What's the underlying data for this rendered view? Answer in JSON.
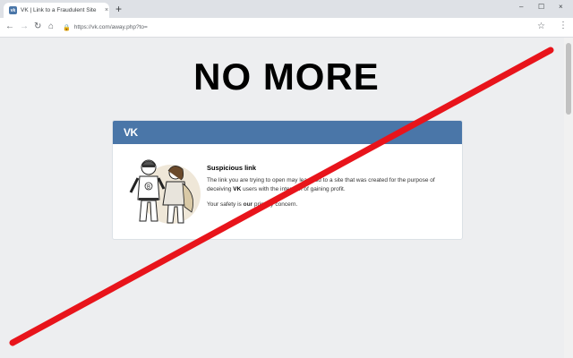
{
  "browser": {
    "tab_title": "VK | Link to a Fraudulent Site",
    "tab_close": "×",
    "new_tab": "+",
    "url": "https://vk.com/away.php?to=",
    "window_controls": [
      "–",
      "☐",
      "×"
    ],
    "nav_icons": [
      "back-icon",
      "forward-icon",
      "reload-icon",
      "home-icon"
    ]
  },
  "headline": "NO MORE",
  "card": {
    "logo": "VK",
    "title": "Suspicious link",
    "text_before": "The link you are trying to open may lead you to a site that was created for the purpose of deceiving ",
    "text_bold": "VK",
    "text_after": " users with the intention of gaining profit.",
    "safety_before": "Your safety is ",
    "safety_bold": "our",
    "safety_after": " primary concern."
  },
  "colors": {
    "vk_blue": "#4a76a8",
    "slash_red": "#e8141b",
    "page_bg": "#edeef0"
  }
}
